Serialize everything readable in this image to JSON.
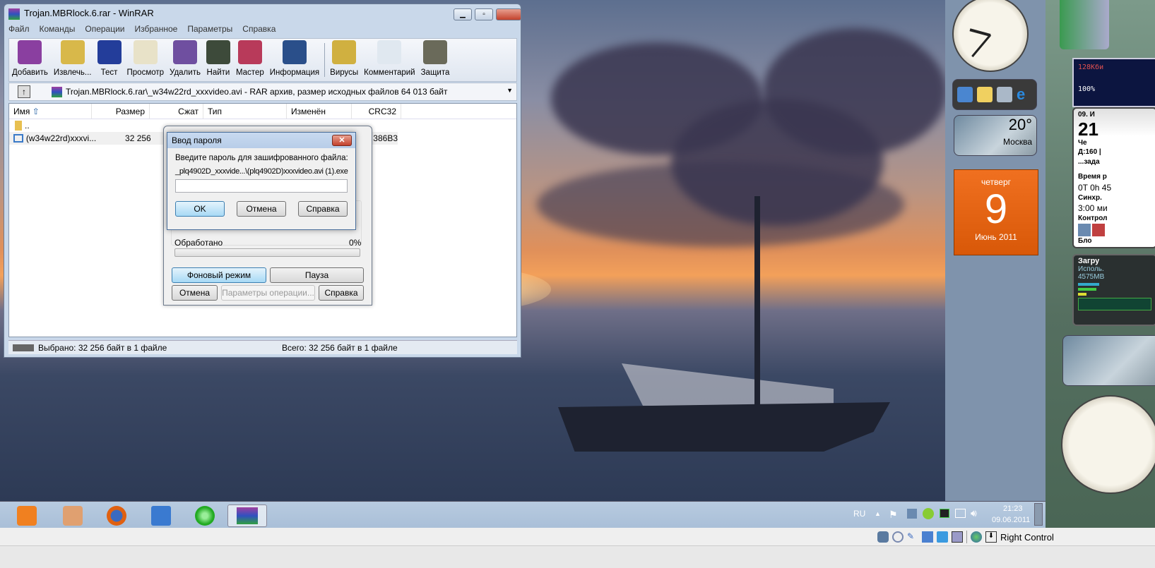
{
  "winrar": {
    "title": "Trojan.MBRlock.6.rar - WinRAR",
    "menu": [
      "Файл",
      "Команды",
      "Операции",
      "Избранное",
      "Параметры",
      "Справка"
    ],
    "toolbar": [
      "Добавить",
      "Извлечь...",
      "Тест",
      "Просмотр",
      "Удалить",
      "Найти",
      "Мастер",
      "Информация",
      "Вирусы",
      "Комментарий",
      "Защита"
    ],
    "toolbar_colors": [
      "#8a3fa0",
      "#d8b84a",
      "#233d9a",
      "#e8e2c8",
      "#6f4fa0",
      "#3d4a3a",
      "#b83a5a",
      "#2a4f8a",
      "#d0b040",
      "#e0e8f0",
      "#6a6a5a"
    ],
    "address": "Trojan.MBRlock.6.rar\\_w34w22rd_xxxvideo.avi - RAR архив, размер исходных файлов 64 013 байт",
    "columns": [
      "Имя",
      "Размер",
      "Сжат",
      "Тип",
      "Изменён",
      "CRC32"
    ],
    "rows": [
      {
        "name": "..",
        "size": "",
        "crc": ""
      },
      {
        "name": "(w34w22rd)xxxvi...",
        "size": "32 256",
        "crc": "386B3"
      }
    ],
    "status_left": "Выбрано: 32 256 байт в 1 файле",
    "status_right": "Всего: 32 256 байт в 1 файле"
  },
  "progress_dialog": {
    "processed_label": "Обработано",
    "processed_value": "0%",
    "progress": 0,
    "background_btn": "Фоновый режим",
    "pause_btn": "Пауза",
    "cancel_btn": "Отмена",
    "params_btn": "Параметры операции...",
    "help_btn": "Справка"
  },
  "password_dialog": {
    "title": "Ввод пароля",
    "prompt": "Введите пароль для зашифрованного файла:",
    "file": "_plq4902D_xxxvide...\\(plq4902D)xxxvideo.avi (1).exe",
    "password": "",
    "ok": "OK",
    "cancel": "Отмена",
    "help": "Справка"
  },
  "gadgets": {
    "weather_temp": "20°",
    "weather_city": "Москва",
    "cal_day": "четверг",
    "cal_date": "9",
    "cal_month": "Июнь 2011",
    "net": "128Кби",
    "net2": "100%",
    "info_date": "09. И",
    "info_time": "21",
    "info_day": "Че",
    "info_d": "Д:160 |",
    "info_tasks": "...зада",
    "uptime_label": "Время р",
    "uptime": "0T 0h 45",
    "sync_label": "Синхр.",
    "sync": "3:00 ми",
    "control": "Контрол",
    "block": "Бло",
    "load": "Загру",
    "used": "Исполь.",
    "mem": "4575MB"
  },
  "taskbar": {
    "lang": "RU",
    "time": "21:23",
    "date": "09.06.2011",
    "apps": [
      "media-player",
      "downloader",
      "firefox",
      "control-panel",
      "green-app",
      "winrar"
    ]
  },
  "vbox": {
    "host_key": "Right Control"
  }
}
